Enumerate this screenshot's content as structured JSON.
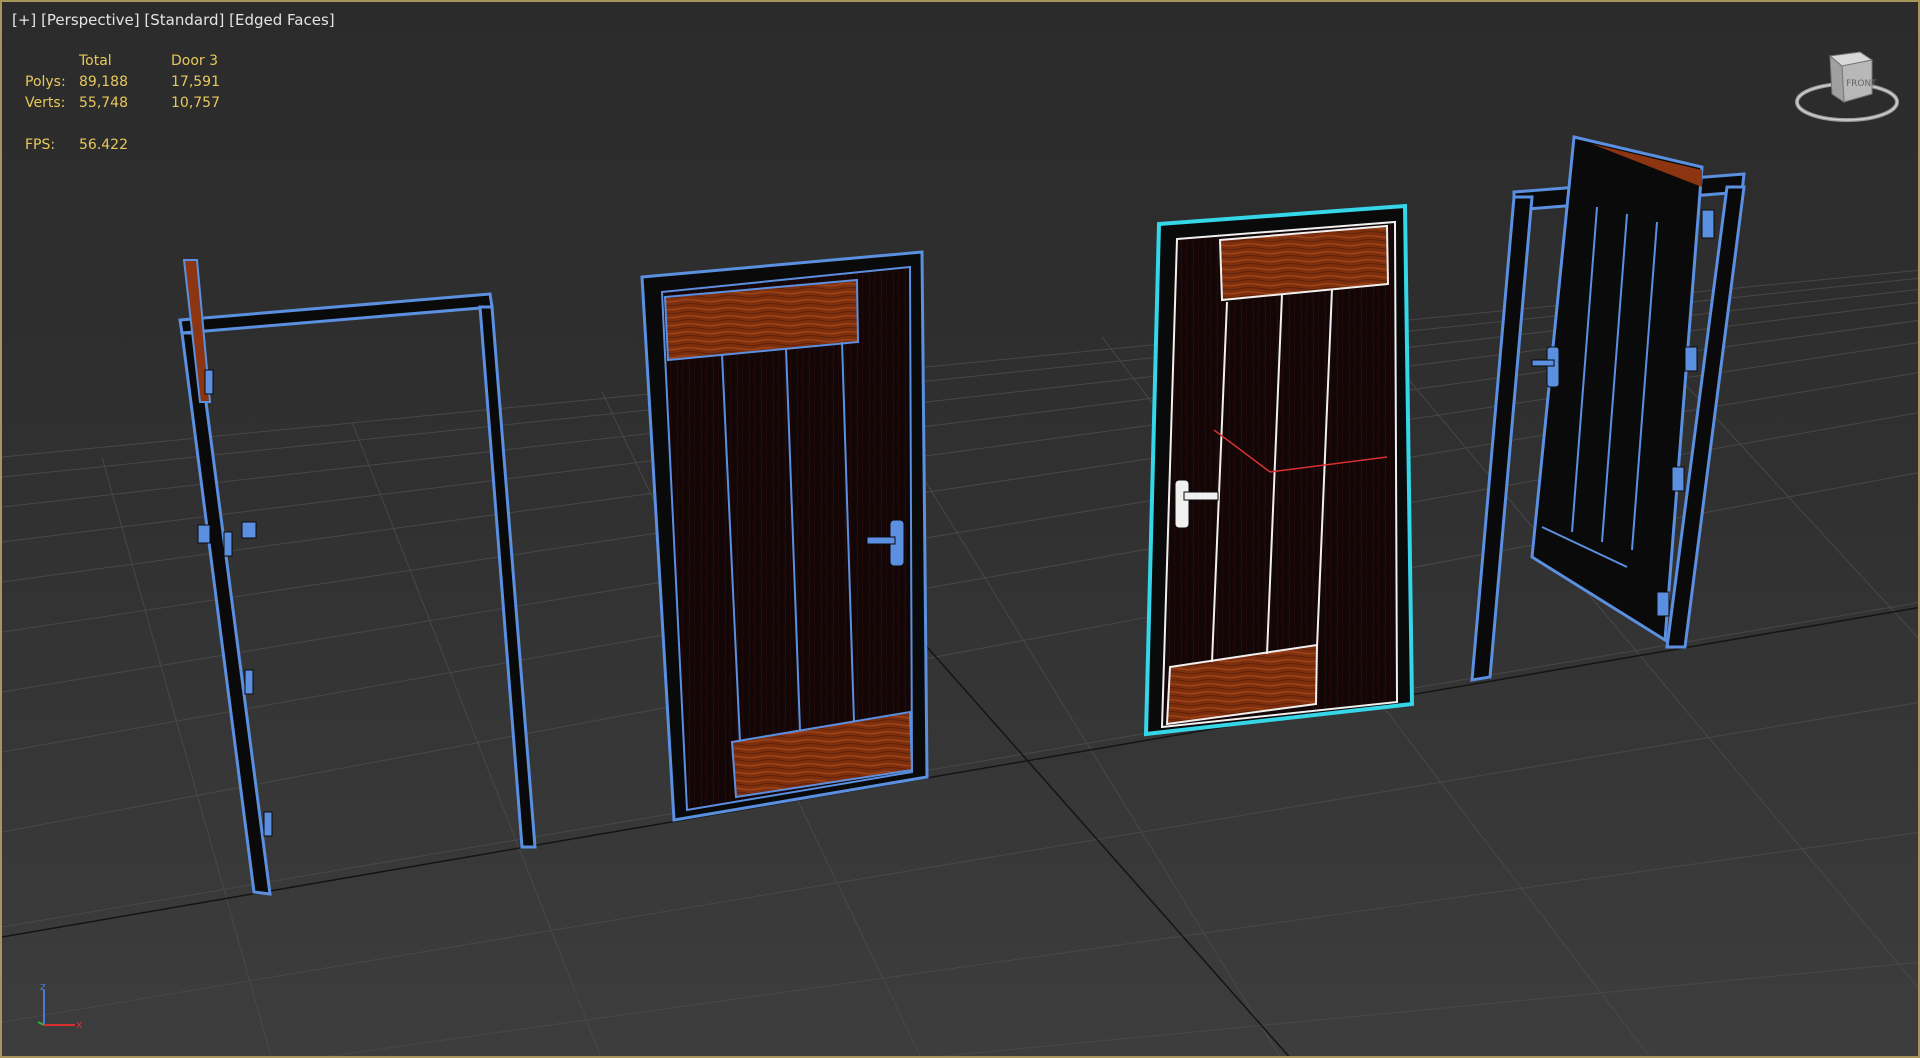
{
  "viewport": {
    "label_plus": "[+]",
    "label_view": "[Perspective]",
    "label_shading": "[Standard]",
    "label_edges": "[Edged Faces]"
  },
  "stats": {
    "header_total": "Total",
    "header_selected": "Door 3",
    "polys_label": "Polys:",
    "polys_total": "89,188",
    "polys_selected": "17,591",
    "verts_label": "Verts:",
    "verts_total": "55,748",
    "verts_selected": "10,757",
    "fps_label": "FPS:",
    "fps_value": "56.422"
  },
  "viewcube": {
    "face_label": "FRONT"
  },
  "axis": {
    "x": "x",
    "z": "z"
  },
  "colors": {
    "frame_edge": "#5b8fe0",
    "selection": "#34d6e8",
    "wood": "#8c3510",
    "stats_text": "#e7c85c",
    "viewport_border": "#a7955c"
  }
}
